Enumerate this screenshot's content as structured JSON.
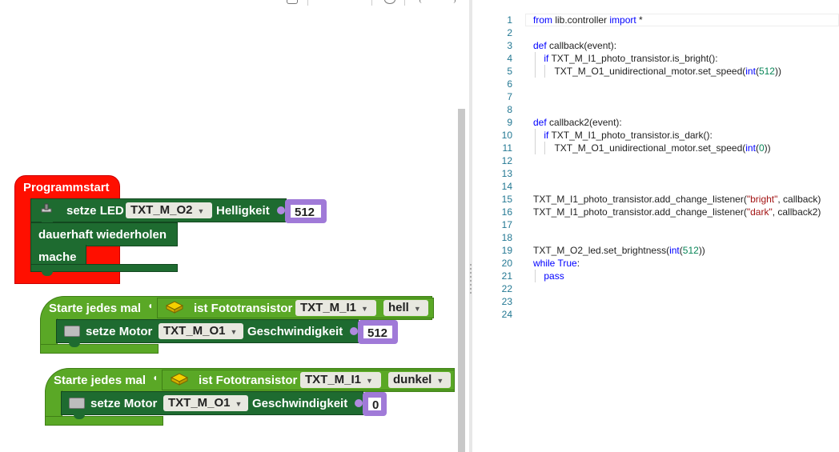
{
  "workspace": {
    "program_start": {
      "label": "Programmstart",
      "set_led": {
        "label": "setze LED",
        "port": "TXT_M_O2",
        "param": "Helligkeit",
        "value": "512"
      },
      "forever": {
        "label": "dauerhaft wiederholen",
        "do": "mache"
      }
    },
    "event1": {
      "label": "Starte jedes mal",
      "sensor_label": "ist Fototransistor",
      "sensor": "TXT_M_I1",
      "state": "hell",
      "motor": {
        "label": "setze Motor",
        "port": "TXT_M_O1",
        "param": "Geschwindigkeit",
        "value": "512"
      }
    },
    "event2": {
      "label": "Starte jedes mal",
      "sensor_label": "ist Fototransistor",
      "sensor": "TXT_M_I1",
      "state": "dunkel",
      "motor": {
        "label": "setze Motor",
        "port": "TXT_M_O1",
        "param": "Geschwindigkeit",
        "value": "0"
      }
    }
  },
  "editor": {
    "lines": [
      "from lib.controller import *",
      "",
      "def callback(event):",
      "    if TXT_M_I1_photo_transistor.is_bright():",
      "        TXT_M_O1_unidirectional_motor.set_speed(int(512))",
      "",
      "",
      "",
      "def callback2(event):",
      "    if TXT_M_I1_photo_transistor.is_dark():",
      "        TXT_M_O1_unidirectional_motor.set_speed(int(0))",
      "",
      "",
      "",
      "TXT_M_I1_photo_transistor.add_change_listener(\"bright\", callback)",
      "TXT_M_I1_photo_transistor.add_change_listener(\"dark\", callback2)",
      "",
      "",
      "TXT_M_O2_led.set_brightness(int(512))",
      "while True:",
      "    pass",
      "",
      "",
      ""
    ],
    "line_numbers": [
      "1",
      "2",
      "3",
      "4",
      "5",
      "6",
      "7",
      "8",
      "9",
      "10",
      "11",
      "12",
      "13",
      "14",
      "15",
      "16",
      "17",
      "18",
      "19",
      "20",
      "21",
      "22",
      "23",
      "24"
    ]
  },
  "colors": {
    "program_start": "#ff0f00",
    "action_block": "#1e6b30",
    "event_block": "#5aa826",
    "value_block": "#a07ad8",
    "keyword": "#0000ff",
    "number": "#098658",
    "string": "#a31515",
    "line_number": "#237893"
  },
  "icons": {
    "led": "led-icon",
    "motor": "motor-icon",
    "sensor": "phototransistor-icon"
  }
}
